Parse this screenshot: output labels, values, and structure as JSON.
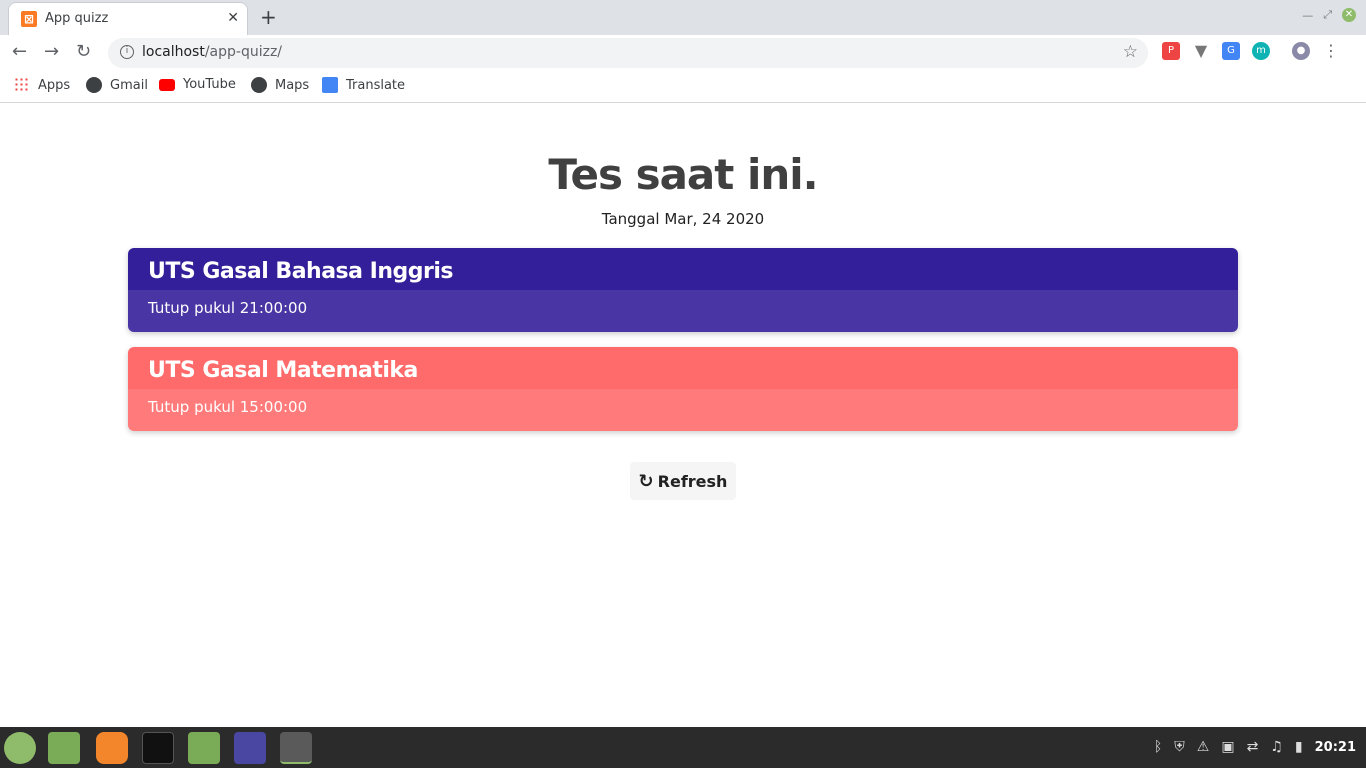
{
  "browser": {
    "tab_title": "App quizz",
    "url_host": "localhost",
    "url_path": "/app-quizz/"
  },
  "bookmarks": [
    "Apps",
    "Gmail",
    "YouTube",
    "Maps",
    "Translate"
  ],
  "page": {
    "title": "Tes saat ini.",
    "date": "Tanggal Mar, 24 2020",
    "cards": [
      {
        "title": "UTS Gasal Bahasa Inggris",
        "close": "Tutup pukul 21:00:00",
        "head_color": "#331f99",
        "body_color": "#4a35a4"
      },
      {
        "title": "UTS Gasal Matematika",
        "close": "Tutup pukul 15:00:00",
        "head_color": "#ff6b6b",
        "body_color": "#ff7b7b"
      }
    ],
    "refresh_label": "Refresh"
  },
  "taskbar": {
    "clock": "20:21"
  }
}
